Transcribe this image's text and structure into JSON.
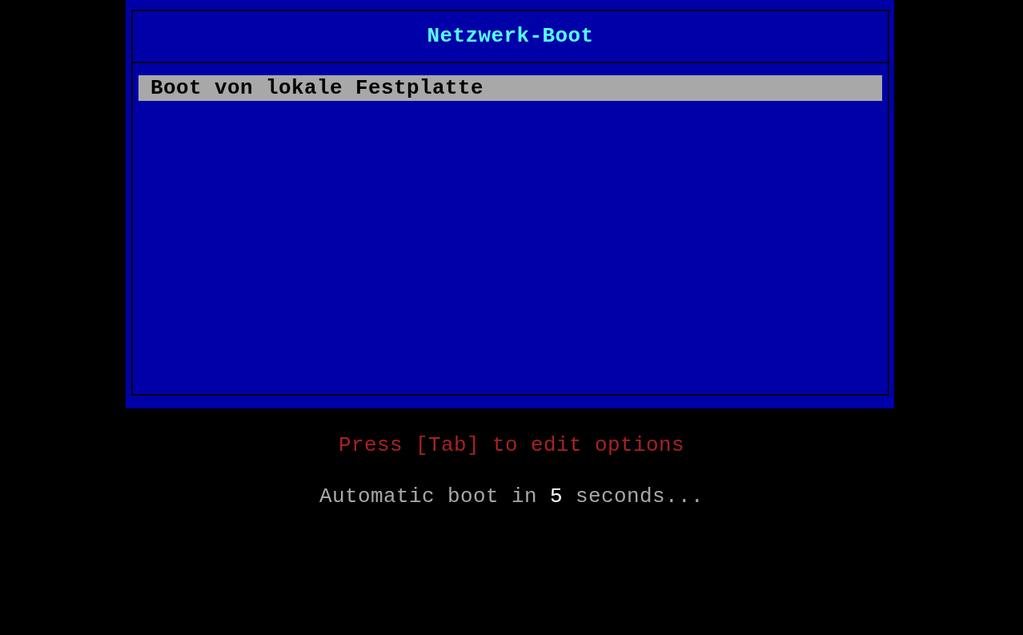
{
  "menu": {
    "title": "Netzwerk-Boot",
    "items": [
      {
        "label": "Boot von lokale Festplatte",
        "selected": true
      }
    ]
  },
  "hint": "Press [Tab] to edit options",
  "countdown": {
    "before": "Automatic boot in",
    "seconds": "5",
    "after": "seconds..."
  }
}
